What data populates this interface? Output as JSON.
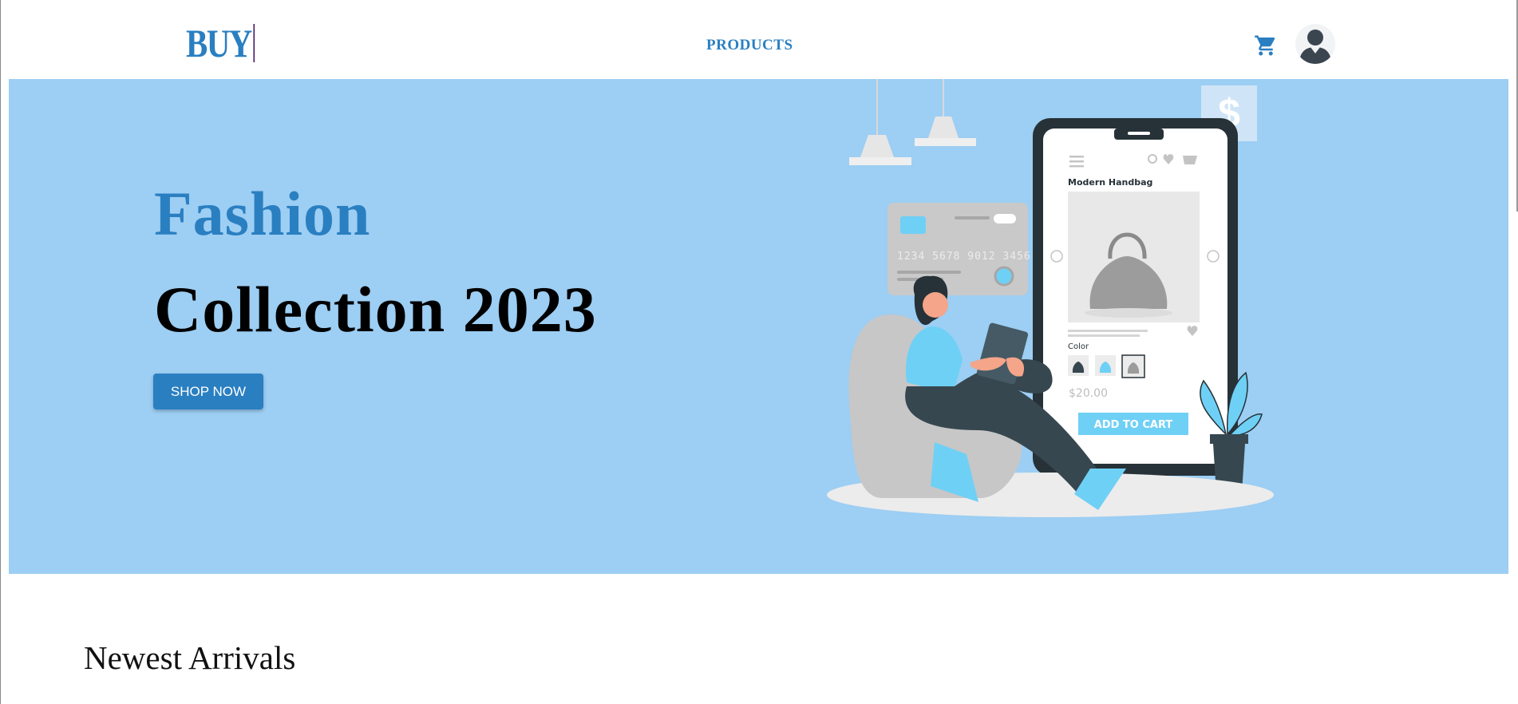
{
  "header": {
    "logo_text": "BUY",
    "nav": {
      "products_label": "PRODUCTS"
    },
    "icons": {
      "cart": "shopping-cart-icon",
      "account": "user-avatar-icon"
    }
  },
  "hero": {
    "title_line_1": "Fashion",
    "title_line_2": "Collection 2023",
    "cta_label": "SHOP NOW",
    "illustration": {
      "card_number": "1234 5678 9012 3456",
      "product_name": "Modern Handbag",
      "color_label": "Color",
      "price": "$20.00",
      "add_to_cart_label": "ADD TO CART",
      "dollar_sign": "$"
    }
  },
  "sections": {
    "newest_title": "Newest Arrivals"
  },
  "colors": {
    "brand": "#2a7fc1",
    "hero_bg": "#9dcef3",
    "text_dark": "#000000",
    "illustration_accent": "#6fd0f5"
  }
}
